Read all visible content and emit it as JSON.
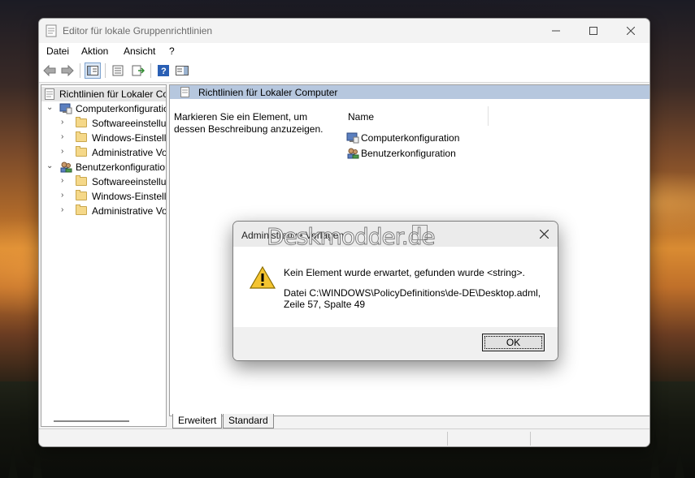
{
  "window": {
    "title": "Editor für lokale Gruppenrichtlinien",
    "minimize_icon": "minimize-icon",
    "maximize_icon": "maximize-icon",
    "close_icon": "close-icon"
  },
  "menu": [
    "Datei",
    "Aktion",
    "Ansicht",
    "?"
  ],
  "toolbar": [
    "back-arrow-icon",
    "forward-arrow-icon",
    "show-hide-tree-icon",
    "properties-icon",
    "export-list-icon",
    "help-icon",
    "toggle-pane-icon"
  ],
  "tree": {
    "root": "Richtlinien für Lokaler Computer",
    "nodes": [
      {
        "label": "Computerkonfiguration",
        "level": 1,
        "expanded": true,
        "icon": "computer-icon"
      },
      {
        "label": "Softwareeinstellungen",
        "level": 2,
        "icon": "folder-icon"
      },
      {
        "label": "Windows-Einstellungen",
        "level": 2,
        "icon": "folder-icon"
      },
      {
        "label": "Administrative Vorlagen",
        "level": 2,
        "icon": "folder-icon"
      },
      {
        "label": "Benutzerkonfiguration",
        "level": 1,
        "expanded": true,
        "icon": "users-icon"
      },
      {
        "label": "Softwareeinstellungen",
        "level": 2,
        "icon": "folder-icon"
      },
      {
        "label": "Windows-Einstellungen",
        "level": 2,
        "icon": "folder-icon"
      },
      {
        "label": "Administrative Vorlagen",
        "level": 2,
        "icon": "folder-icon"
      }
    ]
  },
  "main": {
    "header": "Richtlinien für Lokaler Computer",
    "description": "Markieren Sie ein Element, um dessen Beschreibung anzuzeigen.",
    "column": "Name",
    "items": [
      "Computerkonfiguration",
      "Benutzerkonfiguration"
    ]
  },
  "tabs": [
    "Erweitert",
    "Standard"
  ],
  "dialog": {
    "title": "Administrative Vorlagen",
    "watermark": "Deskmodder.de",
    "message": "Kein Element wurde erwartet, gefunden wurde <string>.",
    "detail_line1": "Datei C:\\WINDOWS\\PolicyDefinitions\\de-DE\\Desktop.adml,",
    "detail_line2": "Zeile 57, Spalte 49",
    "ok_label": "OK"
  },
  "colors": {
    "header_blue": "#b6c7de",
    "selection": "#e5e5e5",
    "warning_yellow": "#f4c430"
  }
}
